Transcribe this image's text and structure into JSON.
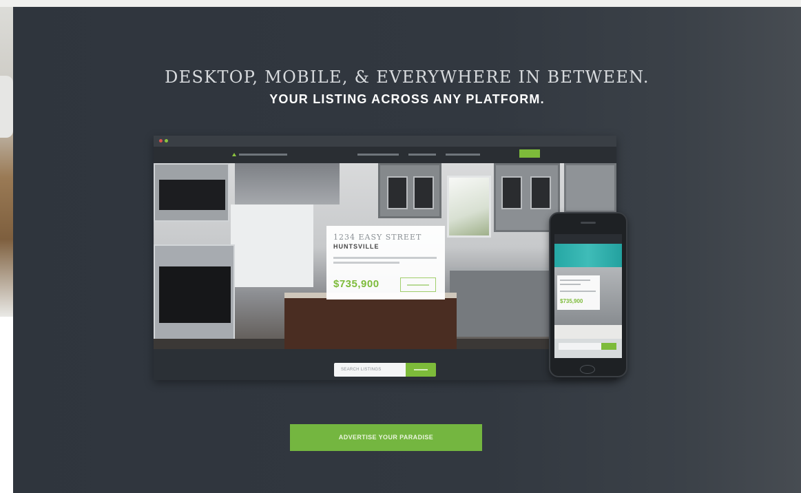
{
  "hero": {
    "headline_line1": "DESKTOP, MOBILE, & EVERYWHERE IN BETWEEN.",
    "headline_line2": "YOUR LISTING ACROSS ANY PLATFORM."
  },
  "desktop_mockup": {
    "listing_address": "1234 EASY STREET",
    "listing_city": "HUNTSVILLE",
    "listing_price": "$735,900",
    "search_placeholder": "SEARCH LISTINGS"
  },
  "mobile_mockup": {
    "listing_price": "$735,900"
  },
  "cta": {
    "label": "ADVERTISE YOUR PARADISE"
  },
  "colors": {
    "accent_green": "#7dbb3a",
    "hero_background": "#31373f"
  }
}
